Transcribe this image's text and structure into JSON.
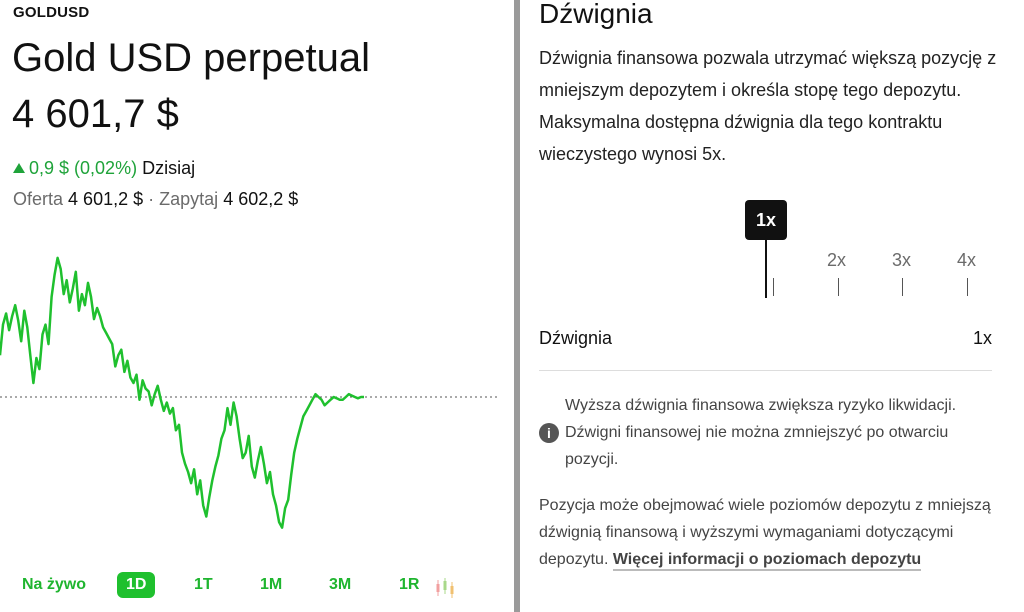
{
  "left": {
    "ticker": "GOLDUSD",
    "title": "Gold USD perpetual",
    "price": "4 601,7 $",
    "change": "0,9 $ (0,02%)",
    "change_period": "Dzisiaj",
    "bid_label": "Oferta",
    "bid_value": "4 601,2 $",
    "ask_sep": "·",
    "ask_label": "Zapytaj",
    "ask_value": "4 602,2 $",
    "line_color": "#1fc02e",
    "ranges": [
      "Na żywo",
      "1D",
      "1T",
      "1M",
      "3M",
      "1R"
    ],
    "active_range": "1D",
    "chart_icon": "candlestick-icon"
  },
  "chart_data": {
    "type": "line",
    "title": "",
    "xlabel": "",
    "ylabel": "",
    "baseline": "previous close",
    "x": [
      0,
      1,
      2,
      3,
      4,
      5,
      6,
      7,
      8,
      9,
      10,
      11,
      12,
      13,
      14,
      15,
      16,
      17,
      18,
      19,
      20,
      21,
      22,
      23,
      24,
      25,
      26,
      27,
      28,
      29,
      30,
      31,
      32,
      33,
      34,
      35,
      36,
      37,
      38,
      39,
      40,
      41,
      42,
      43,
      44,
      45,
      46,
      47,
      48,
      49,
      50,
      51,
      52,
      53,
      54,
      55,
      56,
      57,
      58,
      59,
      60,
      61,
      62,
      63,
      64,
      65,
      66,
      67,
      68,
      69,
      70,
      71,
      72,
      73,
      74,
      75,
      76,
      77,
      78,
      79,
      80,
      81,
      82,
      83,
      84,
      85,
      86,
      87,
      88,
      89,
      90,
      91,
      92,
      93,
      94,
      95,
      96,
      97,
      98,
      99,
      100,
      101,
      102,
      103,
      104,
      105,
      106,
      107,
      108,
      109,
      110,
      111,
      112,
      113,
      114,
      115,
      116,
      117,
      118,
      119,
      120
    ],
    "values": [
      30,
      52,
      60,
      48,
      58,
      66,
      55,
      40,
      62,
      50,
      30,
      10,
      28,
      20,
      45,
      52,
      38,
      72,
      88,
      100,
      92,
      74,
      84,
      68,
      78,
      90,
      62,
      74,
      66,
      82,
      72,
      56,
      64,
      58,
      50,
      46,
      42,
      38,
      22,
      30,
      34,
      18,
      26,
      14,
      10,
      16,
      -2,
      12,
      6,
      4,
      -6,
      2,
      8,
      -2,
      -10,
      -4,
      -12,
      -8,
      -24,
      -20,
      -40,
      -48,
      -54,
      -62,
      -52,
      -70,
      -60,
      -78,
      -86,
      -72,
      -60,
      -50,
      -42,
      -30,
      -24,
      -8,
      -20,
      -4,
      -14,
      -30,
      -44,
      -40,
      -28,
      -50,
      -58,
      -46,
      -36,
      -48,
      -62,
      -54,
      -70,
      -78,
      -90,
      -94,
      -80,
      -74,
      -56,
      -40,
      -30,
      -22,
      -14,
      -10,
      -6,
      -2,
      2,
      0,
      -2,
      -6,
      -4,
      -2,
      0,
      -1,
      -2,
      -2,
      0,
      2,
      1,
      0,
      -1,
      0,
      0
    ],
    "reference_line": 0,
    "ylim": [
      -100,
      110
    ]
  },
  "right": {
    "title": "Dźwignia",
    "description": "Dźwignia finansowa pozwala utrzymać większą pozycję z mniejszym depozytem i określa stopę tego depozytu. Maksymalna dostępna dźwignia dla tego kontraktu wieczystego wynosi 5x.",
    "selector": {
      "selected": "1x",
      "options": [
        "1x",
        "2x",
        "3x",
        "4x"
      ]
    },
    "row_label": "Dźwignia",
    "row_value": "1x",
    "info_icon": "info-icon",
    "warning": "Wyższa dźwignia finansowa zwiększa ryzyko likwidacji. Dźwigni finansowej nie można zmniejszyć po otwarciu pozycji.",
    "more_text": "Pozycja może obejmować wiele poziomów depozytu z mniejszą dźwignią finansową i wyższymi wymaganiami dotyczącymi depozytu.",
    "more_link": "Więcej informacji o poziomach depozytu"
  }
}
